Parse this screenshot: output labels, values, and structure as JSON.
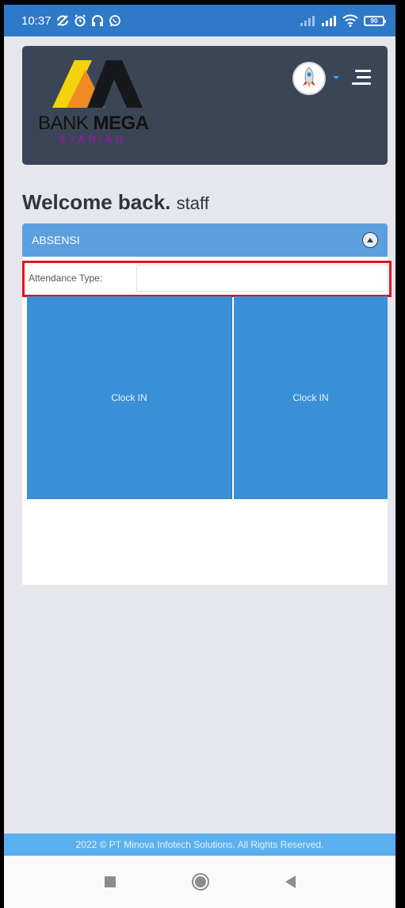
{
  "status_bar": {
    "time": "10:37",
    "battery": "90",
    "icons": [
      "no-sync-icon",
      "alarm-icon",
      "headset-icon",
      "whatsapp-icon",
      "signal-icon",
      "signal-icon",
      "wifi-icon",
      "battery-icon"
    ]
  },
  "header": {
    "logo": {
      "brand_text_1": "BANK",
      "brand_text_2": "MEGA",
      "brand_sub": "SYARIAH"
    },
    "avatar_icon": "rocket-icon",
    "menu_icon": "hamburger-menu-icon"
  },
  "welcome": {
    "text": "Welcome back.",
    "user": "staff"
  },
  "panel": {
    "title": "ABSENSI",
    "collapse_icon": "chevron-up-icon",
    "attendance_label": "Attendance Type:",
    "attendance_value": "",
    "buttons": [
      {
        "label": "Clock IN"
      },
      {
        "label": "Clock IN"
      }
    ]
  },
  "footer": {
    "text": "2022 © PT Minova Infotech Solutions. All Rights Reserved."
  },
  "colors": {
    "status_bar": "#2f79c9",
    "header_card": "#3a4656",
    "panel_header": "#5c9fdf",
    "clock_button": "#3a90d6",
    "highlight": "#e8111c",
    "footer": "#5ab0ee"
  }
}
